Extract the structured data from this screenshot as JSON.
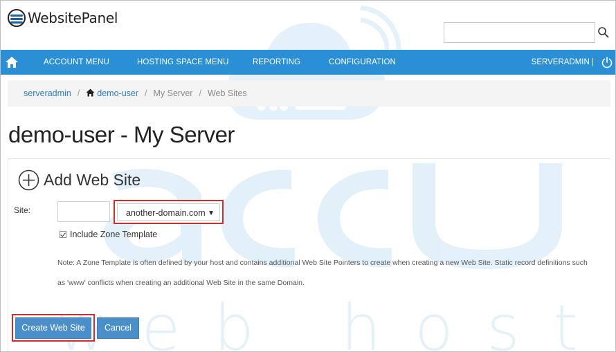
{
  "header": {
    "brand": "WebsitePanel",
    "search": {
      "value": "",
      "placeholder": ""
    },
    "search_icon": "search-icon"
  },
  "nav": {
    "home_icon": "home-icon",
    "items": [
      {
        "label": "ACCOUNT MENU"
      },
      {
        "label": "HOSTING SPACE MENU"
      },
      {
        "label": "REPORTING"
      },
      {
        "label": "CONFIGURATION"
      }
    ],
    "user": "SERVERADMIN |",
    "power_icon": "power-icon",
    "color": "#2b8fd6"
  },
  "breadcrumb": {
    "items": [
      {
        "label": "serveradmin",
        "link": true
      },
      {
        "label": "demo-user",
        "link": true,
        "icon": "home-icon"
      },
      {
        "label": "My Server",
        "link": false
      },
      {
        "label": "Web Sites",
        "link": false
      }
    ],
    "separator": "/"
  },
  "page": {
    "title": "demo-user - My Server"
  },
  "form": {
    "heading": "Add Web Site",
    "heading_icon": "add-circle-icon",
    "site_label": "Site:",
    "host_value": "",
    "domain_selected": "another-domain.com",
    "include_zone_template": {
      "label": "Include Zone Template",
      "checked": true
    },
    "note": "Note: A Zone Template is often defined by your host and contains additional Web Site Pointers to create when creating a new Web Site. Static record definitions such as 'www' conflicts when creating an additional Web Site in the same Domain.",
    "create_button": "Create Web Site",
    "cancel_button": "Cancel",
    "highlight_color": "#d52b2b"
  },
  "watermark": {
    "line1": "accu",
    "line2": "web hosting"
  }
}
